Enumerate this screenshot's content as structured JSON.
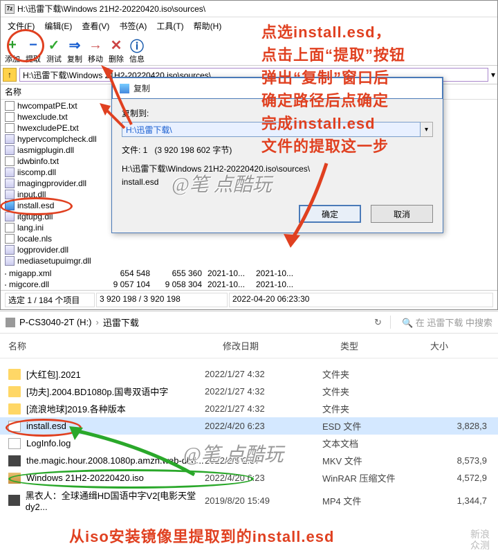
{
  "sevenZip": {
    "title": "H:\\迅雷下载\\Windows 21H2-20220420.iso\\sources\\",
    "icon7z": "7z",
    "menu": [
      "文件(F)",
      "编辑(E)",
      "查看(V)",
      "书签(A)",
      "工具(T)",
      "帮助(H)"
    ],
    "toolbar": [
      {
        "label": "添加",
        "icon": "+"
      },
      {
        "label": "提取",
        "icon": "−"
      },
      {
        "label": "测试",
        "icon": "✓"
      },
      {
        "label": "复制",
        "icon": "⇒"
      },
      {
        "label": "移动",
        "icon": "→"
      },
      {
        "label": "删除",
        "icon": "✕"
      },
      {
        "label": "信息",
        "icon": "ⓘ"
      }
    ],
    "path": "H:\\迅雷下载\\Windows 21H2-20220420.iso\\sources\\",
    "colsHeader": "名称",
    "files": [
      {
        "name": "hwcompatPE.txt",
        "type": "file"
      },
      {
        "name": "hwexclude.txt",
        "type": "file"
      },
      {
        "name": "hwexcludePE.txt",
        "type": "file"
      },
      {
        "name": "hypervcomplcheck.dll",
        "type": "dll"
      },
      {
        "name": "iasmigplugin.dll",
        "type": "dll"
      },
      {
        "name": "idwbinfo.txt",
        "type": "file"
      },
      {
        "name": "iiscomp.dll",
        "type": "dll"
      },
      {
        "name": "imagingprovider.dll",
        "type": "dll"
      },
      {
        "name": "input.dll",
        "type": "dll"
      },
      {
        "name": "install.esd",
        "type": "img"
      },
      {
        "name": "itgtupg.dll",
        "type": "dll"
      },
      {
        "name": "lang.ini",
        "type": "file"
      },
      {
        "name": "locale.nls",
        "type": "file"
      },
      {
        "name": "logprovider.dll",
        "type": "dll"
      },
      {
        "name": "mediasetupuimgr.dll",
        "type": "dll"
      }
    ],
    "info": [
      {
        "name": "migapp.xml",
        "c2": "654 548",
        "c3": "655 360",
        "c4": "2021-10...",
        "c5": "2021-10..."
      },
      {
        "name": "migcore.dll",
        "c2": "9 057 104",
        "c3": "9 058 304",
        "c4": "2021-10...",
        "c5": "2021-10..."
      }
    ],
    "status": {
      "left": "选定 1 / 184 个项目",
      "mid": "3 920 198 / 3 920 198",
      "right": "2022-04-20 06:23:30"
    }
  },
  "dialog": {
    "title": "复制",
    "dest_label": "复制到:",
    "dest_value": "H:\\迅雷下载\\",
    "files_label": "文件: 1",
    "bytes": "(3 920 198 602 字节)",
    "source_path": "H:\\迅雷下载\\Windows 21H2-20220420.iso\\sources\\",
    "source_file": "install.esd",
    "ok": "确定",
    "cancel": "取消"
  },
  "explorer": {
    "drive": "P-CS3040-2T (H:)",
    "folder": "迅雷下载",
    "search_placeholder": "在 迅雷下载 中搜索",
    "cols": {
      "name": "名称",
      "mod": "修改日期",
      "type": "类型",
      "size": "大小"
    },
    "rows": [
      {
        "name": "[大红包].2021",
        "mod": "2022/1/27 4:32",
        "type": "文件夹",
        "size": "",
        "ico": "folder"
      },
      {
        "name": "[功夫].2004.BD1080p.国粤双语中字",
        "mod": "2022/1/27 4:32",
        "type": "文件夹",
        "size": "",
        "ico": "folder"
      },
      {
        "name": "[流浪地球]2019.各种版本",
        "mod": "2022/1/27 4:32",
        "type": "文件夹",
        "size": "",
        "ico": "folder"
      },
      {
        "name": "install.esd",
        "mod": "2022/4/20 6:23",
        "type": "ESD 文件",
        "size": "3,828,3",
        "ico": "txt",
        "sel": true
      },
      {
        "name": "LogInfo.log",
        "mod": "",
        "type": "文本文档",
        "size": "",
        "ico": "txt"
      },
      {
        "name": "the.magic.hour.2008.1080p.amzn.web-dl.d...",
        "mod": "2022/2/5 2:37",
        "type": "MKV 文件",
        "size": "8,573,9",
        "ico": "vid"
      },
      {
        "name": "Windows 21H2-20220420.iso",
        "mod": "2022/4/20 6:23",
        "type": "WinRAR 压缩文件",
        "size": "4,572,9",
        "ico": "rar"
      },
      {
        "name": "黑衣人：全球通缉HD国语中字V2[电影天堂dy2...",
        "mod": "2019/8/20 15:49",
        "type": "MP4 文件",
        "size": "1,344,7",
        "ico": "vid"
      }
    ]
  },
  "annotations": {
    "top": "点选install.esd，\n点击上面“提取”按钮\n弹出“复制”窗口后\n确定路径后点确定\n完成install.esd\n文件的提取这一步",
    "bottom": "从iso安装镜像里提取到的install.esd",
    "watermark": "@笔 点酷玩",
    "logo1": "新浪",
    "logo2": "众测"
  }
}
